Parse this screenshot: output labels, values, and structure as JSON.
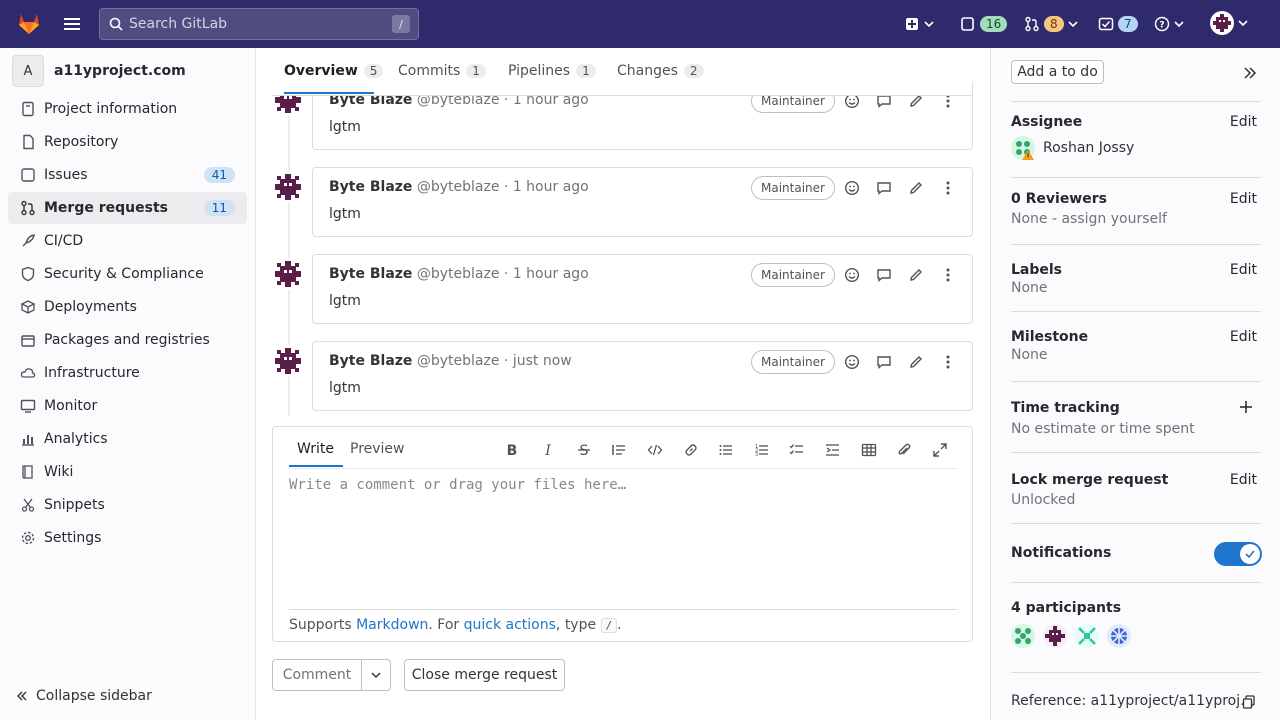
{
  "topbar": {
    "search_placeholder": "Search GitLab",
    "search_shortcut": "/",
    "issues_count": "16",
    "mr_count": "8",
    "todos_count": "7"
  },
  "sidebar": {
    "project_initial": "A",
    "project_name": "a11yproject.com",
    "items": [
      {
        "label": "Project information",
        "icon": "info-icon"
      },
      {
        "label": "Repository",
        "icon": "doc-icon"
      },
      {
        "label": "Issues",
        "icon": "issues-icon",
        "count": "41"
      },
      {
        "label": "Merge requests",
        "icon": "merge-request-icon",
        "count": "11",
        "active": true
      },
      {
        "label": "CI/CD",
        "icon": "rocket-icon"
      },
      {
        "label": "Security & Compliance",
        "icon": "shield-icon"
      },
      {
        "label": "Deployments",
        "icon": "deploy-icon"
      },
      {
        "label": "Packages and registries",
        "icon": "package-icon"
      },
      {
        "label": "Infrastructure",
        "icon": "cloud-icon"
      },
      {
        "label": "Monitor",
        "icon": "monitor-icon"
      },
      {
        "label": "Analytics",
        "icon": "chart-icon"
      },
      {
        "label": "Wiki",
        "icon": "book-icon"
      },
      {
        "label": "Snippets",
        "icon": "scissors-icon"
      },
      {
        "label": "Settings",
        "icon": "gear-icon"
      }
    ],
    "collapse_label": "Collapse sidebar"
  },
  "tabs": [
    {
      "label": "Overview",
      "count": "5"
    },
    {
      "label": "Commits",
      "count": "1"
    },
    {
      "label": "Pipelines",
      "count": "1"
    },
    {
      "label": "Changes",
      "count": "2"
    }
  ],
  "notes": [
    {
      "author": "Byte Blaze",
      "handle": "@byteblaze",
      "time": "1 hour ago",
      "role": "Maintainer",
      "body": "lgtm"
    },
    {
      "author": "Byte Blaze",
      "handle": "@byteblaze",
      "time": "1 hour ago",
      "role": "Maintainer",
      "body": "lgtm"
    },
    {
      "author": "Byte Blaze",
      "handle": "@byteblaze",
      "time": "1 hour ago",
      "role": "Maintainer",
      "body": "lgtm"
    },
    {
      "author": "Byte Blaze",
      "handle": "@byteblaze",
      "time": "just now",
      "role": "Maintainer",
      "body": "lgtm"
    }
  ],
  "editor": {
    "write_tab": "Write",
    "preview_tab": "Preview",
    "placeholder": "Write a comment or drag your files here…",
    "footer_prefix": "Supports ",
    "markdown_link": "Markdown",
    "footer_mid": ". For ",
    "quick_actions_link": "quick actions",
    "footer_suffix": ", type ",
    "slash": "/",
    "footer_end": "."
  },
  "actions": {
    "comment": "Comment",
    "close_mr": "Close merge request"
  },
  "right_sidebar": {
    "add_todo": "Add a to do",
    "edit": "Edit",
    "assignee_title": "Assignee",
    "assignee_name": "Roshan Jossy",
    "reviewers_title": "0 Reviewers",
    "reviewers_value": "None - assign yourself",
    "labels_title": "Labels",
    "labels_value": "None",
    "milestone_title": "Milestone",
    "milestone_value": "None",
    "time_title": "Time tracking",
    "time_value": "No estimate or time spent",
    "lock_title": "Lock merge request",
    "lock_value": "Unlocked",
    "notifications_title": "Notifications",
    "participants_title": "4 participants",
    "reference": "Reference: a11yproject/a11yproj…"
  },
  "colors": {
    "topbar": "#2f2a6b",
    "accent": "#1f75cb"
  }
}
